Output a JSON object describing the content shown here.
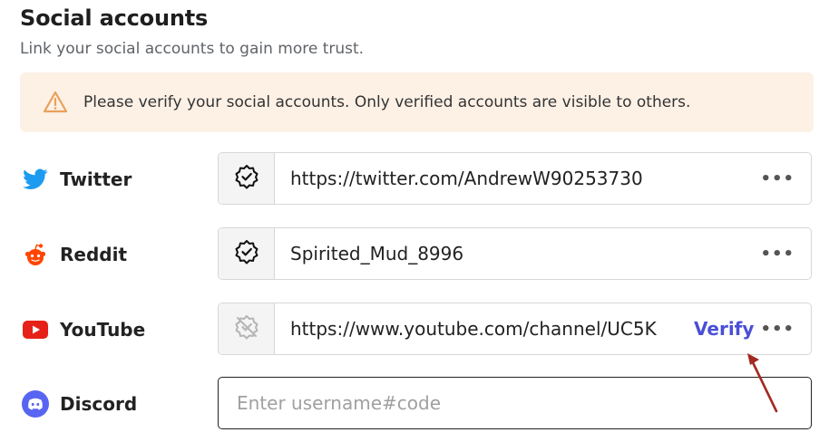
{
  "header": {
    "title": "Social accounts",
    "subtitle": "Link your social accounts to gain more trust."
  },
  "alert": {
    "icon": "warning-icon",
    "text": "Please verify your social accounts. Only verified accounts are visible to others.",
    "bg_color": "#fdf1e6",
    "icon_color": "#e8a15a"
  },
  "accounts": [
    {
      "platform": "Twitter",
      "icon": "twitter-icon",
      "value": "https://twitter.com/AndrewW90253730",
      "verified": true,
      "more": "•••"
    },
    {
      "platform": "Reddit",
      "icon": "reddit-icon",
      "value": "Spirited_Mud_8996",
      "verified": true,
      "more": "•••"
    },
    {
      "platform": "YouTube",
      "icon": "youtube-icon",
      "value": "https://www.youtube.com/channel/UC5K",
      "verified": false,
      "verify_label": "Verify",
      "more": "•••"
    },
    {
      "platform": "Discord",
      "icon": "discord-icon",
      "value": "",
      "placeholder": "Enter username#code"
    }
  ],
  "colors": {
    "accent": "#4a4fd6",
    "twitter": "#1d9bf0",
    "reddit": "#ff4500",
    "youtube": "#e62117",
    "discord": "#5865f2",
    "annotation_arrow": "#a32a22"
  }
}
